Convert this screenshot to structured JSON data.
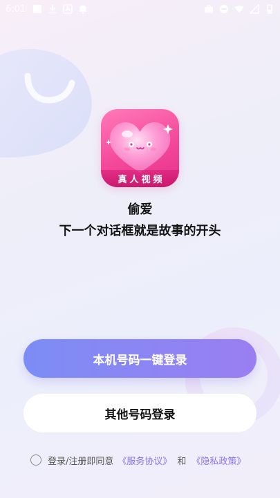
{
  "status_bar": {
    "time": "6:01",
    "left_icons": [
      "gallery-icon",
      "download-icon",
      "translate-icon",
      "notification-icon"
    ],
    "right_icons": [
      "briefcase-icon",
      "dnd-icon",
      "wifi-icon",
      "signal-icon",
      "battery-icon"
    ]
  },
  "app": {
    "icon_badge": "真人视频",
    "name": "偷爱",
    "tagline": "下一个对话框就是故事的开头"
  },
  "buttons": {
    "primary_label": "本机号码一键登录",
    "secondary_label": "其他号码登录"
  },
  "agreement": {
    "prefix": "登录/注册即同意",
    "service_link": "《服务协议》",
    "conjunction": "和",
    "privacy_link": "《隐私政策》",
    "checked": false
  },
  "colors": {
    "primary_gradient_start": "#7c8df5",
    "primary_gradient_end": "#9a7ef2",
    "link": "#8c73e8",
    "icon_pink": "#f4489a",
    "text_dark": "#141414"
  }
}
